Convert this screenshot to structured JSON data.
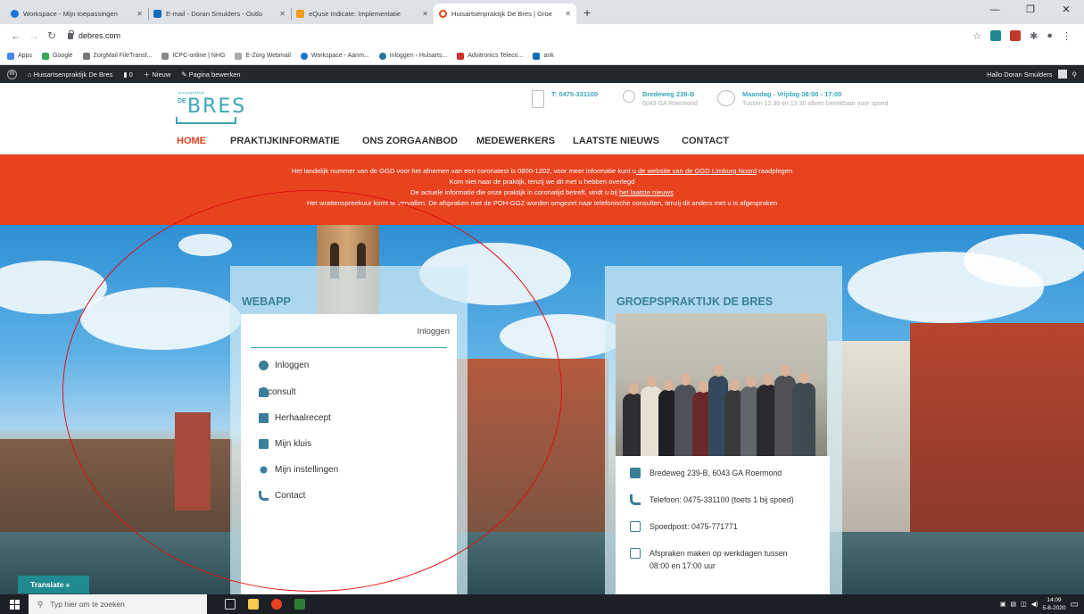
{
  "browser": {
    "tabs": [
      {
        "title": "Workspace - Mijn toepassingen",
        "color": "#1976d2"
      },
      {
        "title": "E-mail - Doran Smulders - Outlo",
        "color": "#0f6cbd"
      },
      {
        "title": "eQuse Indicate: Implementatie",
        "color": "#f39c12"
      },
      {
        "title": "Huisartsenpraktijk De Bres | Groe",
        "color": "#e8421f"
      }
    ],
    "active_tab": 3,
    "new_tab": "+",
    "url": "debres.com",
    "bookmarks": [
      {
        "label": "Apps",
        "color": "#4285f4"
      },
      {
        "label": "Google",
        "color": "#34a853"
      },
      {
        "label": "ZorgMail FileTransf...",
        "color": "#777777"
      },
      {
        "label": "ICPC-online | NHG",
        "color": "#888888"
      },
      {
        "label": "E-Zorg Webmail",
        "color": "#aaaaaa"
      },
      {
        "label": "Workspace - Aanm...",
        "color": "#1976d2"
      },
      {
        "label": "Inloggen ‹ Huisarts...",
        "color": "#21759b"
      },
      {
        "label": "Advitronics Teleco...",
        "color": "#d32f2f"
      },
      {
        "label": "ank",
        "color": "#0f6cbd"
      }
    ]
  },
  "wpbar": {
    "site": "Huisartsenpraktijk De Bres",
    "comments": "0",
    "new": "Nieuw",
    "edit": "Pagina bewerken",
    "greeting": "Hallo Doran Smulders"
  },
  "header": {
    "logo_small": "groepspraktijk",
    "logo_de": "DE",
    "logo_name": "BRES",
    "phone": "T: 0475-331100",
    "address_line1": "Bredeweg 239-B",
    "address_line2": "6043 GA Roermond",
    "hours_line1": "Maandag - Vrijdag 08:00 - 17:00",
    "hours_line2": "Tussen 12.30 en 13.30 alleen bereikbaar voor spoed"
  },
  "nav": [
    "HOME",
    "PRAKTIJKINFORMATIE",
    "ONS ZORGAANBOD",
    "MEDEWERKERS",
    "LAATSTE NIEUWS",
    "CONTACT"
  ],
  "banner": {
    "line1_pre": "Het landelijk nummer van de GGD voor het afnemen van een coronatest is 0800-1202, voor meer informatie kunt u",
    "line1_link": " de website van de GGD Limburg Noord",
    "line1_post": " raadplegen",
    "line2": "Kom niet naar de praktijk, tenzij we dit met u hebben overlegd",
    "line3_pre": "De actuele informatie die onze praktijk in coronatijd betreft, vindt u bij ",
    "line3_link": "het laatste nieuws",
    "line4": "Het wrattenspreekuur komt te vervallen. De afspraken met de POH-GGZ worden omgezet naar telefonische consulten, tenzij dit anders met u is afgesproken"
  },
  "webapp": {
    "title": "WEBAPP",
    "login_header": "Inloggen",
    "items": [
      "Inloggen",
      "E-consult",
      "Herhaalrecept",
      "Mijn kluis",
      "Mijn instellingen",
      "Contact"
    ]
  },
  "practice": {
    "title": "GROEPSPRAKTIJK DE BRES",
    "address": "Bredeweg 239-B, 6043 GA Roermond",
    "phone": "Telefoon: 0475-331100 (toets 1 bij spoed)",
    "emergency": "Spoedpost: 0475-771771",
    "appointments_1": "Afspraken maken op werkdagen tussen",
    "appointments_2": "08:00 en 17:00 uur"
  },
  "translate": "Translate »",
  "taskbar": {
    "search_placeholder": "Typ hier om te zoeken",
    "time": "14:09",
    "date": "5-8-2020"
  }
}
